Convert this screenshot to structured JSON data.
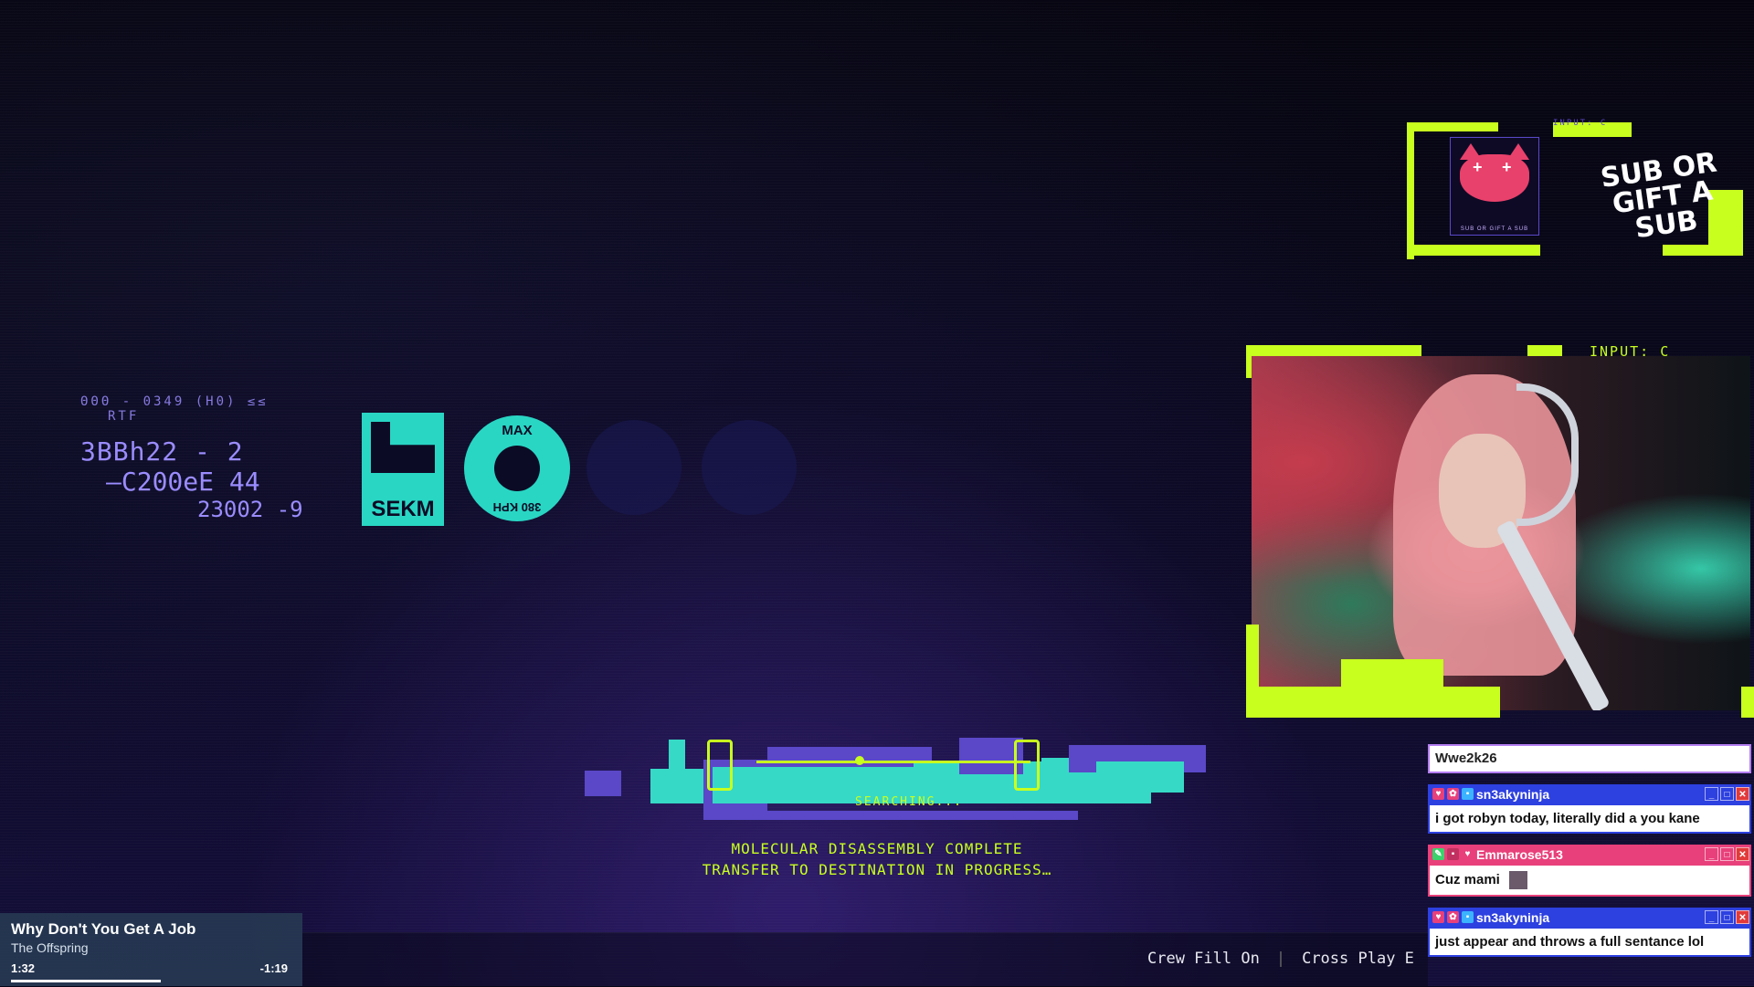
{
  "hud": {
    "code_line1": "ΘΘΘ - 0349 (H0) ≤≤",
    "code_line2": "RTF",
    "code_line3": "3BBh22 - 2",
    "code_line4": "—C200eE 44",
    "code_line5": "23002 -9",
    "sekm_label": "SEKM",
    "dial_max": "MAX",
    "dial_kph": "380 KPH"
  },
  "loader": {
    "searching": "SEARCHING...",
    "message_line1": "MOLECULAR DISASSEMBLY COMPLETE",
    "message_line2": "TRANSFER TO DESTINATION IN PROGRESS…",
    "progress": 0.45
  },
  "sub_panel": {
    "text_line1": "SUB OR",
    "text_line2": "GIFT A SUB",
    "icon_caption": "SUB OR GIFT A SUB",
    "input_label": "INPUT: C"
  },
  "webcam": {
    "input_label": "INPUT: C"
  },
  "chat": {
    "input_value": "Wwe2k26",
    "messages": [
      {
        "user": "sn3akyninja",
        "text": "i got robyn today, literally did a you kane",
        "color": "#2d40e0"
      },
      {
        "user": "Emmarose513",
        "text": "Cuz mami",
        "color": "#e8407a"
      },
      {
        "user": "sn3akyninja",
        "text": "just appear and throws a full sentance lol",
        "color": "#2d40e0"
      }
    ]
  },
  "now_playing": {
    "title": "Why Don't You Get A Job",
    "artist": "The Offspring",
    "elapsed": "1:32",
    "remaining": "-1:19",
    "progress": 0.54
  },
  "ticker": {
    "item1": "Crew Fill On",
    "item2": "Cross Play E"
  },
  "colors": {
    "accent_lime": "#c8ff1e",
    "accent_teal": "#36d9c6",
    "accent_purple": "#5a48c8"
  }
}
